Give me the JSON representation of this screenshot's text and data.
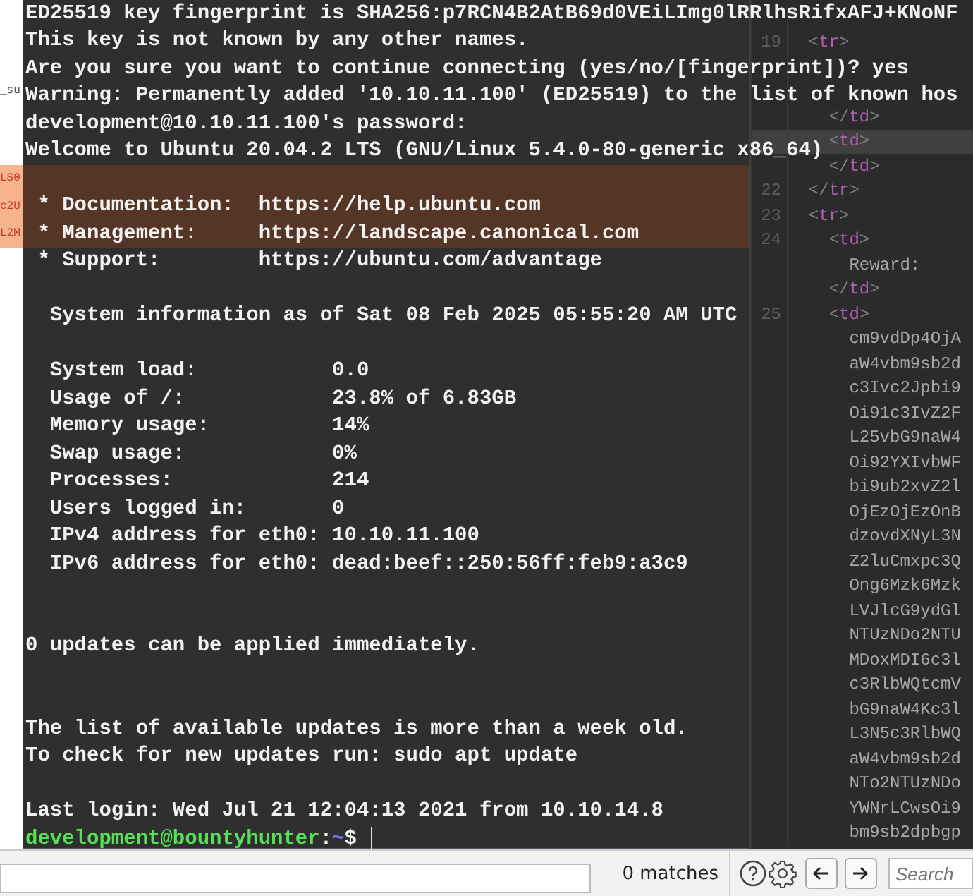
{
  "left_margin": {
    "file_name": "_su",
    "highlighted_lines": [
      "LS0",
      "c2U",
      "L2M"
    ]
  },
  "terminal": {
    "lines": [
      {
        "kind": "text",
        "text": "ED25519 key fingerprint is SHA256:p7RCN4B2AtB69d0VEiLImg0lRRlhsRifxAFJ+KNoNF",
        "highlighted": false
      },
      {
        "kind": "text",
        "text": "This key is not known by any other names.",
        "highlighted": false
      },
      {
        "kind": "text",
        "text": "Are you sure you want to continue connecting (yes/no/[fingerprint])? yes",
        "highlighted": false
      },
      {
        "kind": "text",
        "text": "Warning: Permanently added '10.10.11.100' (ED25519) to the list of known hos",
        "highlighted": false
      },
      {
        "kind": "text",
        "text": "development@10.10.11.100's password:",
        "highlighted": false
      },
      {
        "kind": "text",
        "text": "Welcome to Ubuntu 20.04.2 LTS (GNU/Linux 5.4.0-80-generic x86_64)",
        "highlighted": false
      },
      {
        "kind": "blank",
        "highlighted": true
      },
      {
        "kind": "text",
        "text": " * Documentation:  https://help.ubuntu.com",
        "highlighted": true
      },
      {
        "kind": "text",
        "text": " * Management:     https://landscape.canonical.com",
        "highlighted": true
      },
      {
        "kind": "text",
        "text": " * Support:        https://ubuntu.com/advantage",
        "highlighted": false
      },
      {
        "kind": "blank",
        "highlighted": false
      },
      {
        "kind": "text",
        "text": "  System information as of Sat 08 Feb 2025 05:55:20 AM UTC",
        "highlighted": false
      },
      {
        "kind": "blank",
        "highlighted": false
      },
      {
        "kind": "text",
        "text": "  System load:           0.0",
        "highlighted": false
      },
      {
        "kind": "text",
        "text": "  Usage of /:            23.8% of 6.83GB",
        "highlighted": false
      },
      {
        "kind": "text",
        "text": "  Memory usage:          14%",
        "highlighted": false
      },
      {
        "kind": "text",
        "text": "  Swap usage:            0%",
        "highlighted": false
      },
      {
        "kind": "text",
        "text": "  Processes:             214",
        "highlighted": false
      },
      {
        "kind": "text",
        "text": "  Users logged in:       0",
        "highlighted": false
      },
      {
        "kind": "text",
        "text": "  IPv4 address for eth0: 10.10.11.100",
        "highlighted": false
      },
      {
        "kind": "text",
        "text": "  IPv6 address for eth0: dead:beef::250:56ff:feb9:a3c9",
        "highlighted": false
      },
      {
        "kind": "blank",
        "highlighted": false
      },
      {
        "kind": "blank",
        "highlighted": false
      },
      {
        "kind": "text",
        "text": "0 updates can be applied immediately.",
        "highlighted": false
      },
      {
        "kind": "blank",
        "highlighted": false
      },
      {
        "kind": "blank",
        "highlighted": false
      },
      {
        "kind": "text",
        "text": "The list of available updates is more than a week old.",
        "highlighted": false
      },
      {
        "kind": "text",
        "text": "To check for new updates run: sudo apt update",
        "highlighted": false
      },
      {
        "kind": "blank",
        "highlighted": false
      },
      {
        "kind": "text",
        "text": "Last login: Wed Jul 21 12:04:13 2021 from 10.10.14.8",
        "highlighted": false
      }
    ],
    "prompt": {
      "user_host": "development@bountyhunter",
      "separator": ":",
      "path": "~",
      "symbol": "$"
    }
  },
  "code_editor": {
    "lines": [
      {
        "current": false
      },
      {
        "number": "19",
        "code": "  <tr>",
        "current": false
      },
      {
        "current": false
      },
      {
        "current": false
      },
      {
        "code": "    </td>",
        "current": false
      },
      {
        "code": "    <td>",
        "current": true
      },
      {
        "code": "    </td>",
        "current": false
      },
      {
        "number": "22",
        "code": "  </tr>",
        "current": false
      },
      {
        "number": "23",
        "code": "  <tr>",
        "current": false
      },
      {
        "number": "24",
        "code": "    <td>",
        "current": false
      },
      {
        "code": "      Reward:",
        "current": false
      },
      {
        "code": "    </td>",
        "current": false
      },
      {
        "number": "25",
        "code": "    <td>",
        "current": false
      },
      {
        "code": "      cm9vdDp4OjA",
        "current": false
      },
      {
        "code": "      aW4vbm9sb2d",
        "current": false
      },
      {
        "code": "      c3Ivc2Jpbi9",
        "current": false
      },
      {
        "code": "      Oi91c3IvZ2F",
        "current": false
      },
      {
        "code": "      L25vbG9naW4",
        "current": false
      },
      {
        "code": "      Oi92YXIvbWF",
        "current": false
      },
      {
        "code": "      bi9ub2xvZ2l",
        "current": false
      },
      {
        "code": "      OjEzOjEzOnB",
        "current": false
      },
      {
        "code": "      dzovdXNyL3N",
        "current": false
      },
      {
        "code": "      Z2luCmxpc3Q",
        "current": false
      },
      {
        "code": "      Ong6Mzk6Mzk",
        "current": false
      },
      {
        "code": "      LVJlcG9ydGl",
        "current": false
      },
      {
        "code": "      NTUzNDo2NTU",
        "current": false
      },
      {
        "code": "      MDoxMDI6c3l",
        "current": false
      },
      {
        "code": "      c3RlbWQtcmV",
        "current": false
      },
      {
        "code": "      bG9naW4Kc3l",
        "current": false
      },
      {
        "code": "      L3N5c3RlbWQ",
        "current": false
      },
      {
        "code": "      aW4vbm9sb2d",
        "current": false
      },
      {
        "code": "      NTo2NTUzNDo",
        "current": false
      },
      {
        "code": "      YWNrLCwsOi9",
        "current": false
      },
      {
        "code": "      bm9sb2dpbgp",
        "current": false
      }
    ]
  },
  "find_bar": {
    "matches": "0 matches",
    "search_placeholder": "Search"
  }
}
